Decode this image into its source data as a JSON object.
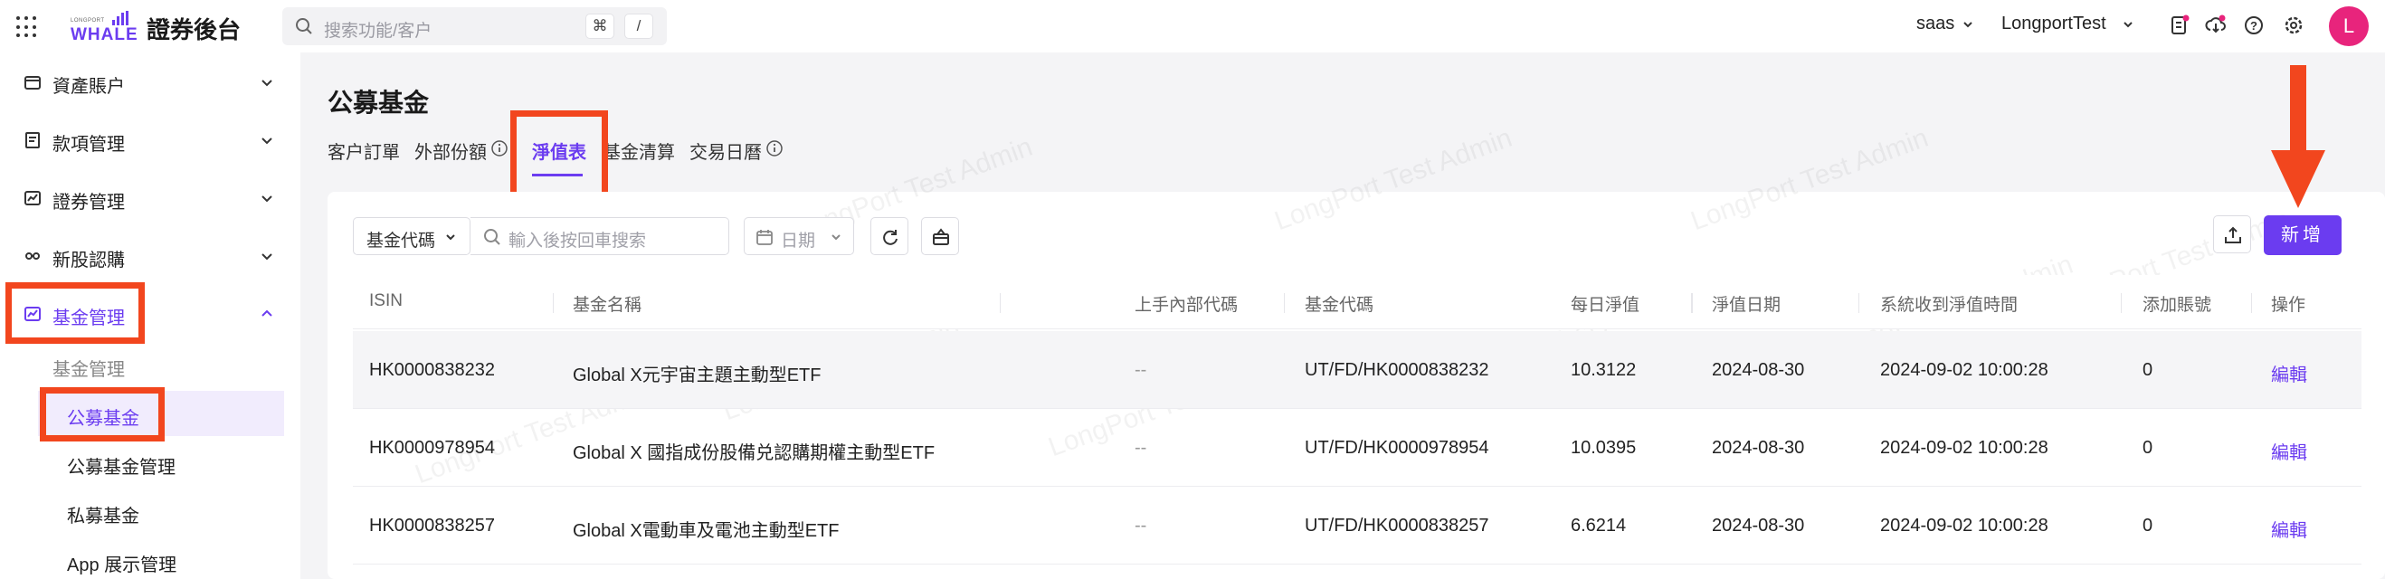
{
  "topbar": {
    "logo_sub": "LONGPORT",
    "logo_text": "WHALE",
    "app_title": "證券後台",
    "search_placeholder": "搜索功能/客户",
    "kbd_cmd": "⌘",
    "kbd_slash": "/",
    "env": "saas",
    "org": "LongportTest",
    "avatar_letter": "L"
  },
  "sidebar": {
    "items": [
      {
        "label": "資產賬户",
        "icon": "wallet-icon"
      },
      {
        "label": "款項管理",
        "icon": "ledger-icon"
      },
      {
        "label": "證券管理",
        "icon": "chart-box-icon"
      },
      {
        "label": "新股認購",
        "icon": "link-icon"
      },
      {
        "label": "基金管理",
        "icon": "fund-icon"
      }
    ],
    "fund_group_label": "基金管理",
    "sub_items": [
      {
        "label": "公募基金"
      },
      {
        "label": "公募基金管理"
      },
      {
        "label": "私募基金"
      },
      {
        "label": "App 展示管理"
      }
    ]
  },
  "main": {
    "title": "公募基金",
    "tabs": [
      {
        "label": "客户訂單"
      },
      {
        "label": "外部份額"
      },
      {
        "label": "淨值表"
      },
      {
        "label": "基金清算"
      },
      {
        "label": "交易日曆"
      }
    ],
    "watermark": "LongPort Test Admin",
    "filters": {
      "fund_code_select": "基金代碼",
      "search_placeholder": "輸入後按回車搜索",
      "date_placeholder": "日期"
    },
    "add_button": "新增",
    "table": {
      "columns": [
        "ISIN",
        "基金名稱",
        "上手內部代碼",
        "基金代碼",
        "每日淨值",
        "淨值日期",
        "系統收到淨值時間",
        "添加賬號",
        "操作"
      ],
      "rows": [
        {
          "isin": "HK0000838232",
          "name": "Global X元宇宙主題主動型ETF",
          "upstream": "--",
          "code": "UT/FD/HK0000838232",
          "nav": "10.3122",
          "date": "2024-08-30",
          "received": "2024-09-02 10:00:28",
          "account": "0",
          "action": "編輯"
        },
        {
          "isin": "HK0000978954",
          "name": "Global X 國指成份股備兑認購期權主動型ETF",
          "upstream": "--",
          "code": "UT/FD/HK0000978954",
          "nav": "10.0395",
          "date": "2024-08-30",
          "received": "2024-09-02 10:00:28",
          "account": "0",
          "action": "編輯"
        },
        {
          "isin": "HK0000838257",
          "name": "Global X電動車及電池主動型ETF",
          "upstream": "--",
          "code": "UT/FD/HK0000838257",
          "nav": "6.6214",
          "date": "2024-08-30",
          "received": "2024-09-02 10:00:28",
          "account": "0",
          "action": "編輯"
        }
      ]
    }
  },
  "colors": {
    "accent": "#6b3cf0",
    "annotation_red": "#f2461e",
    "avatar": "#e8247c"
  }
}
